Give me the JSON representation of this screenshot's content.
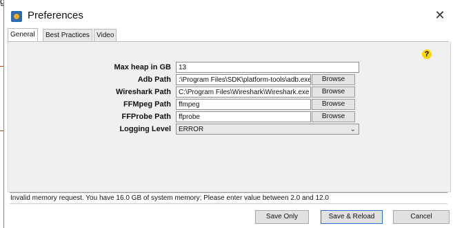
{
  "window": {
    "title": "Preferences"
  },
  "tabs": [
    {
      "label": "General"
    },
    {
      "label": "Best Practices"
    },
    {
      "label": "Video"
    }
  ],
  "form": {
    "max_heap": {
      "label": "Max heap in GB",
      "value": "13"
    },
    "adb_path": {
      "label": "Adb Path",
      "value": ":\\Program Files\\SDK\\platform-tools\\adb.exe",
      "button": "Browse"
    },
    "wireshark_path": {
      "label": "Wireshark Path",
      "value": "C:\\Program Files\\Wireshark\\Wireshark.exe",
      "button": "Browse"
    },
    "ffmpeg_path": {
      "label": "FFMpeg Path",
      "value": "ffmpeg",
      "button": "Browse"
    },
    "ffprobe_path": {
      "label": "FFProbe Path",
      "value": "ffprobe",
      "button": "Browse"
    },
    "logging_level": {
      "label": "Logging Level",
      "value": "ERROR"
    }
  },
  "help": {
    "glyph": "?"
  },
  "status": {
    "message": "Invalid memory request. You have 16.0 GB of system memory; Please enter value between 2.0 and 12.0"
  },
  "buttons": {
    "save_only": "Save Only",
    "save_reload": "Save & Reload",
    "cancel": "Cancel"
  },
  "icons": {
    "close": "close-icon",
    "app": "app-icon",
    "help": "help-icon",
    "chevron": "chevron-down-icon"
  },
  "colors": {
    "accent": "#2d6fd6",
    "help_badge": "#ffd500"
  }
}
